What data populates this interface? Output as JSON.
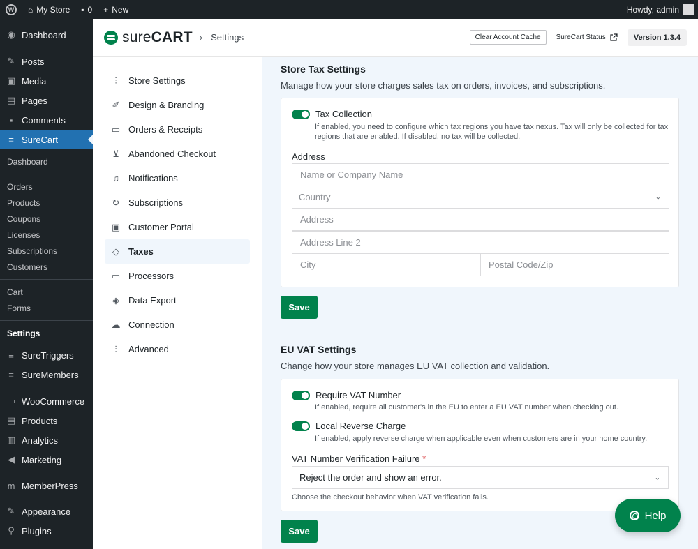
{
  "adminbar": {
    "site_name": "My Store",
    "comments_count": "0",
    "new_label": "New",
    "howdy": "Howdy, admin"
  },
  "sidebar": {
    "top_items": [
      {
        "label": "Dashboard",
        "icon": "dashboard-icon"
      },
      {
        "label": "Posts",
        "icon": "pin-icon"
      },
      {
        "label": "Media",
        "icon": "media-icon"
      },
      {
        "label": "Pages",
        "icon": "pages-icon"
      },
      {
        "label": "Comments",
        "icon": "comments-icon"
      },
      {
        "label": "SureCart",
        "icon": "surecart-icon"
      }
    ],
    "surecart_sub": {
      "dashboard": "Dashboard",
      "group1": [
        "Orders",
        "Products",
        "Coupons",
        "Licenses",
        "Subscriptions",
        "Customers"
      ],
      "group2": [
        "Cart",
        "Forms"
      ],
      "settings": "Settings"
    },
    "bottom_items": [
      {
        "label": "SureTriggers",
        "icon": "suretriggers-icon"
      },
      {
        "label": "SureMembers",
        "icon": "suremembers-icon"
      },
      {
        "label": "WooCommerce",
        "icon": "woocommerce-icon"
      },
      {
        "label": "Products",
        "icon": "products-icon"
      },
      {
        "label": "Analytics",
        "icon": "analytics-icon"
      },
      {
        "label": "Marketing",
        "icon": "marketing-icon"
      },
      {
        "label": "MemberPress",
        "icon": "memberpress-icon"
      },
      {
        "label": "Appearance",
        "icon": "appearance-icon"
      },
      {
        "label": "Plugins",
        "icon": "plugins-icon"
      }
    ]
  },
  "header": {
    "logo_text_light": "sure",
    "logo_text_bold": "CART",
    "breadcrumb": "Settings",
    "clear_cache": "Clear Account Cache",
    "status": "SureCart Status",
    "version": "Version 1.3.4"
  },
  "settings_nav": [
    {
      "label": "Store Settings",
      "icon": "sliders-icon"
    },
    {
      "label": "Design & Branding",
      "icon": "brush-icon"
    },
    {
      "label": "Orders & Receipts",
      "icon": "inbox-icon"
    },
    {
      "label": "Abandoned Checkout",
      "icon": "cart-icon"
    },
    {
      "label": "Notifications",
      "icon": "bell-icon"
    },
    {
      "label": "Subscriptions",
      "icon": "refresh-icon"
    },
    {
      "label": "Customer Portal",
      "icon": "briefcase-icon"
    },
    {
      "label": "Taxes",
      "icon": "tag-icon"
    },
    {
      "label": "Processors",
      "icon": "credit-card-icon"
    },
    {
      "label": "Data Export",
      "icon": "layers-icon"
    },
    {
      "label": "Connection",
      "icon": "cloud-icon"
    },
    {
      "label": "Advanced",
      "icon": "sliders-icon"
    }
  ],
  "tax": {
    "title": "Store Tax Settings",
    "desc": "Manage how your store charges sales tax on orders, invoices, and subscriptions.",
    "toggle_label": "Tax Collection",
    "toggle_help": "If enabled, you need to configure which tax regions you have tax nexus. Tax will only be collected for tax regions that are enabled. If disabled, no tax will be collected.",
    "address_label": "Address",
    "name_placeholder": "Name or Company Name",
    "country_placeholder": "Country",
    "address_placeholder": "Address",
    "address2_placeholder": "Address Line 2",
    "city_placeholder": "City",
    "zip_placeholder": "Postal Code/Zip",
    "save": "Save"
  },
  "vat": {
    "title": "EU VAT Settings",
    "desc": "Change how your store manages EU VAT collection and validation.",
    "require_label": "Require VAT Number",
    "require_help": "If enabled, require all customer's in the EU to enter a EU VAT number when checking out.",
    "reverse_label": "Local Reverse Charge",
    "reverse_help": "If enabled, apply reverse charge when applicable even when customers are in your home country.",
    "failure_label": "VAT Number Verification Failure",
    "required_mark": "*",
    "failure_value": "Reject the order and show an error.",
    "failure_help": "Choose the checkout behavior when VAT verification fails.",
    "save": "Save"
  },
  "help_button": "Help"
}
